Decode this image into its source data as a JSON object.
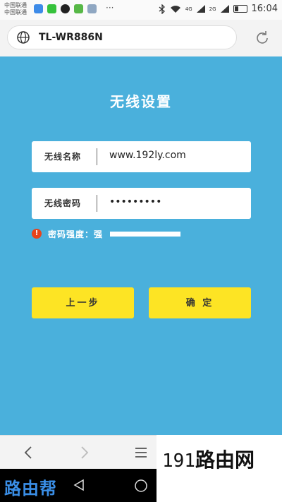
{
  "status_bar": {
    "carrier_line1": "中国联通",
    "carrier_line2": "中国联通",
    "more": "···",
    "signal1_label": "4G",
    "signal2_label": "2G",
    "time": "16:04"
  },
  "address_bar": {
    "url": "TL-WR886N"
  },
  "form": {
    "title": "无线设置",
    "ssid_label": "无线名称",
    "ssid_value": "www.192ly.com",
    "password_label": "无线密码",
    "password_value": "•••••••••",
    "strength_text": "密码强度：强",
    "strength_level": 1.0,
    "prev_button": "上一步",
    "confirm_button": "确 定"
  },
  "watermark": {
    "left": "路由帮",
    "right_num": "191",
    "right_text": "路由网"
  },
  "colors": {
    "background": "#4ab0dc",
    "button": "#fde424",
    "warning": "#e8431b"
  }
}
